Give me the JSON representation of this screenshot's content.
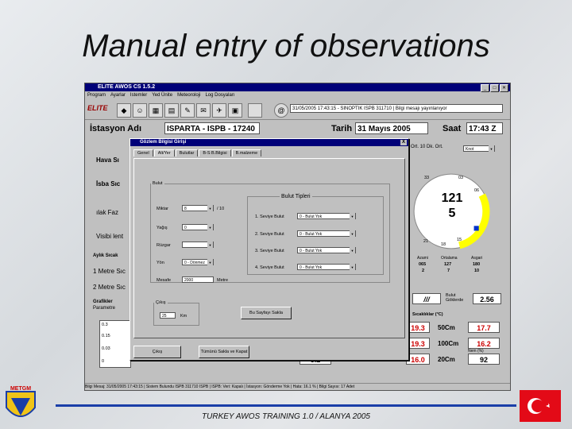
{
  "slide": {
    "title": "Manual  entry of observations",
    "footer": "TURKEY AWOS TRAINING 1.0 / ALANYA 2005",
    "logo_text": "METGM"
  },
  "window": {
    "title": "ELITE AWOS CS 1.5.2",
    "menu": [
      "Program",
      "Ayarlar",
      "Istemler",
      "Yed Ünite",
      "Meteoroloji",
      "Log Dosyaları"
    ],
    "brand": "ELITE",
    "info_combo": "31/05/2005 17:43:15 - SINOPTIK ISPB 311710 | Bilgi mesajı yayınlanıyor"
  },
  "header": {
    "station_label": "İstasyon Adı",
    "station_value": "ISPARTA - ISPB - 17240",
    "date_label": "Tarih",
    "date_value": "31 Mayıs 2005",
    "time_label": "Saat",
    "time_value": "17:43 Z"
  },
  "left_labels": [
    "Hava Sı",
    "İsba Sıc",
    "ılak Faz",
    "Visibi lent",
    "Aylık Sıcak",
    "1 Metre Sıc",
    "2 Metre Sıc",
    "Grafikler",
    "Parametre"
  ],
  "dialog": {
    "title": "Gözlem Bilgisi Girişi",
    "close": "X",
    "tabs": [
      "Genel",
      "Alt/Yer",
      "Bulutlar",
      "B-S B.Bilgisi",
      "B.malzeme"
    ],
    "bulut_legend": "Bulut",
    "rows": [
      {
        "label": "Miktar",
        "value": "8",
        "suffix": "/ 10"
      },
      {
        "label": "Yağış",
        "value": "0"
      },
      {
        "label": "Rüzgar",
        "value": ""
      },
      {
        "label": "Yön",
        "value": "0 - Dönmez"
      },
      {
        "label": "Mesafe",
        "value": "2000",
        "suffix": "Metre"
      }
    ],
    "bulut_tipleri_legend": "Bulut Tipleri",
    "cloud_levels": [
      {
        "label": "1. Seviye Bulut",
        "value": "0 - Bulut Yok"
      },
      {
        "label": "2. Seviye Bulut",
        "value": "0 - Bulut Yok"
      },
      {
        "label": "3. Seviye Bulut",
        "value": "0 - Bulut Yok"
      },
      {
        "label": "4. Seviye Bulut",
        "value": "0 - Bulut Yok"
      }
    ],
    "cikis_legend": "Çıkış",
    "cikis_value": "25",
    "cikis_unit": "Km",
    "apply_button": "Bu Sayfayı Sakla",
    "cancel_button": "Çıkış",
    "save_all_button": "Tümünü Sakla ve Kapat"
  },
  "right": {
    "wind_tab": "Ort.  10 Dk. Ort.",
    "wind_combo": "Knot",
    "gauge_value": "121",
    "gauge_sub": "5",
    "ticks": [
      "33",
      "03",
      "06",
      "21",
      "15",
      "12",
      "18",
      "24",
      "27",
      "30"
    ],
    "stats_headers": [
      "Azami",
      "Ortalama",
      "Asgari"
    ],
    "stats_row1": [
      "065",
      "127",
      "180"
    ],
    "stats_row2": [
      "2",
      "7",
      "10"
    ],
    "nem_label": "Nem (%)",
    "bulut_label": "Bulut Göklerde",
    "small_value": "2.56",
    "slash_value": "///",
    "temps_title": "Sıcaklıklar (°C)",
    "temp_rows": [
      {
        "left": "19.3",
        "depth": "50Cm",
        "right": "17.7"
      },
      {
        "left": "19.3",
        "depth": "100Cm",
        "right": "16.2"
      },
      {
        "left": "16.0",
        "depth": "20Cm",
        "right": "92"
      }
    ],
    "left_small": "5.2"
  },
  "status": "Bilgi Mesaj: 31/05/2005 17:43:15 | Sistem Bulundu ISPB 311710 ISPB | ISPB: Veri: Kapalı | İstasyon: Gönderme Yok | Hata: 16.1 % | Bilgi Sayısı: 17 Adet",
  "chart_axis": [
    "0.3",
    "0.15",
    "0.03",
    "0"
  ],
  "colors": {
    "title_bar": "#000078",
    "gauge_fill": "#ffff00",
    "value_red": "#cc0000",
    "flag_red": "#e30a17"
  }
}
